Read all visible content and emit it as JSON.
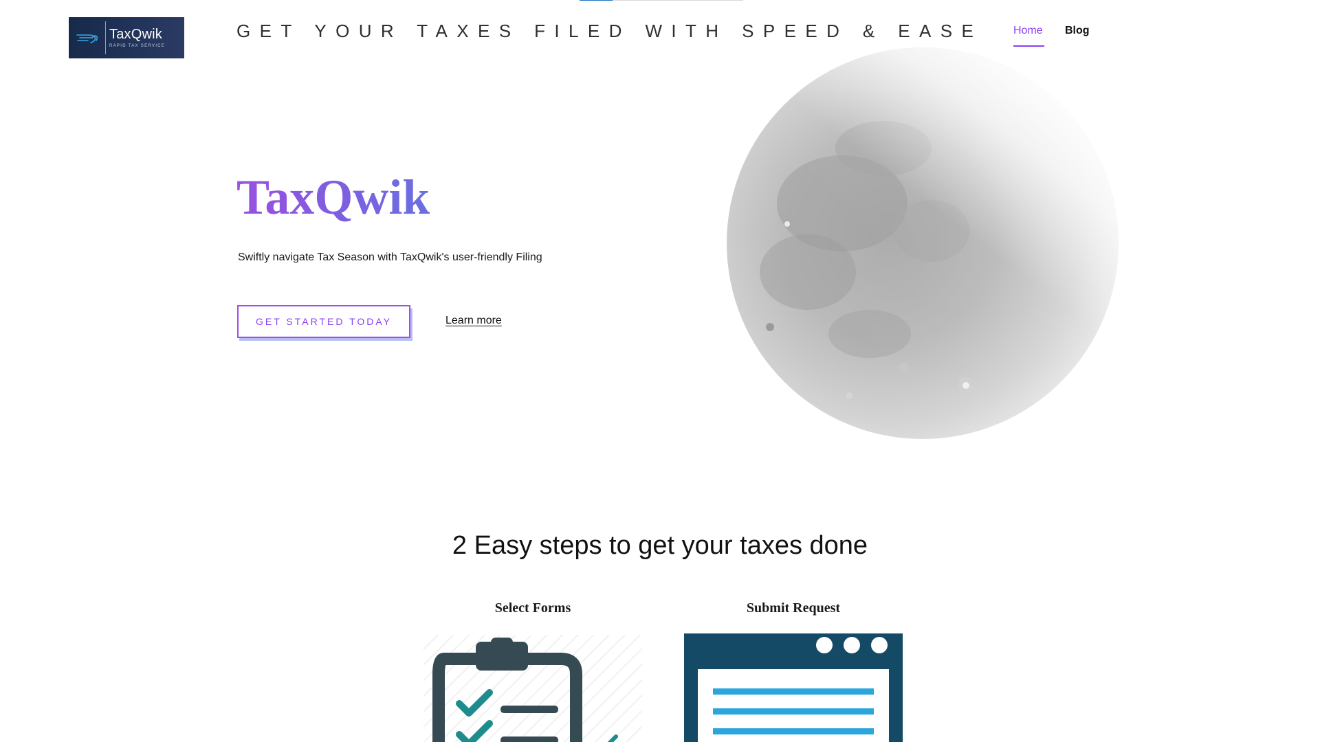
{
  "header": {
    "logo": {
      "name": "TaxQwik",
      "subtitle": "RAPID TAX SERVICE",
      "icon": "speed-lines-icon"
    },
    "tagline": "GET YOUR TAXES FILED WITH SPEED & EASE",
    "nav": [
      {
        "label": "Home",
        "active": true
      },
      {
        "label": "Blog",
        "active": false
      }
    ]
  },
  "hero": {
    "title": "TaxQwik",
    "subtitle": "Swiftly navigate Tax Season with TaxQwik's user-friendly Filing",
    "cta_label": "GET STARTED TODAY",
    "secondary_link": "Learn more",
    "image": "moon-illustration"
  },
  "steps": {
    "heading": "2 Easy steps to get your taxes done",
    "items": [
      {
        "title": "Select Forms",
        "icon": "clipboard-checklist-icon"
      },
      {
        "title": "Submit Request",
        "icon": "browser-window-form-icon"
      }
    ]
  },
  "colors": {
    "accent": "#8b3ff0",
    "accent_gradient_end": "#6a6fe0",
    "logo_bg": "#1c2f52",
    "step2_bg": "#144a66",
    "step2_lines": "#2aa6dc",
    "clipboard": "#354a52",
    "check": "#1e8c8c"
  }
}
